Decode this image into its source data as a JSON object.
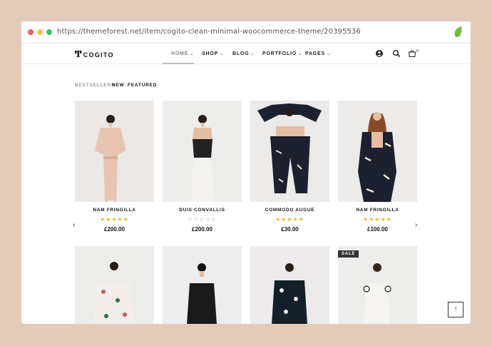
{
  "browser": {
    "url": "https://themeforest.net/item/cogito-clean-minimal-woocommerce-theme/20395536"
  },
  "site": {
    "logo_mark": "Ͳ",
    "logo_text": "COGITO",
    "nav": [
      {
        "label": "HOME",
        "active": true
      },
      {
        "label": "SHOP"
      },
      {
        "label": "BLOG"
      },
      {
        "label": "PORTFOLIO"
      },
      {
        "label": "PAGES"
      }
    ],
    "caret": "⌄",
    "cart_count": "0"
  },
  "filters": [
    "BESTSELLERS",
    "NEW",
    "FEATURED"
  ],
  "products_row1": [
    {
      "name": "NAM FRINGILLA",
      "stars": "★★★★★",
      "rating": 5,
      "price": "£200.00"
    },
    {
      "name": "DUIS CONVALLIS",
      "stars": "☆☆☆☆☆",
      "rating": 0,
      "price": "£200.00"
    },
    {
      "name": "COMMODO AUGUE",
      "stars": "★★★★★",
      "rating": 5,
      "price": "£30.00"
    },
    {
      "name": "NAM FRINGILLA",
      "stars": "★★★★★",
      "rating": 5,
      "price": "£100.00"
    }
  ],
  "products_row2": [
    {
      "badge": ""
    },
    {
      "badge": ""
    },
    {
      "badge": ""
    },
    {
      "badge": "SALE"
    }
  ],
  "controls": {
    "prev": "‹",
    "next": "›",
    "to_top": "↑"
  },
  "colors": {
    "page_bg": "#e3cbb9",
    "star": "#f3b41e",
    "sale_badge": "#333333"
  }
}
